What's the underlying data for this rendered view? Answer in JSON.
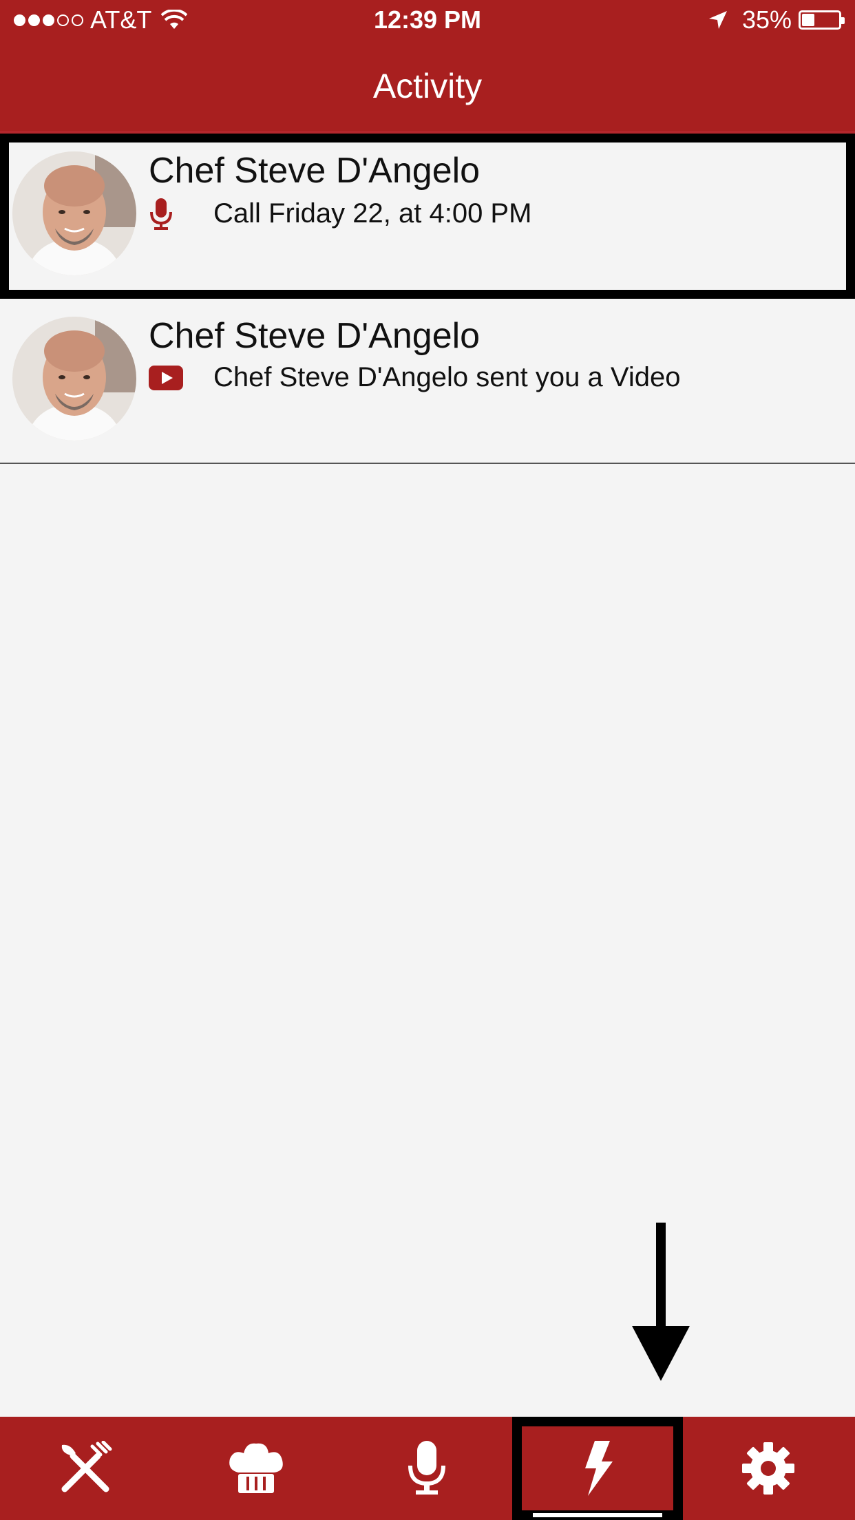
{
  "status_bar": {
    "carrier": "AT&T",
    "time": "12:39 PM",
    "battery_percent": "35%",
    "signal_bars_filled": 3,
    "signal_bars_total": 5,
    "battery_level": 0.35
  },
  "header": {
    "title": "Activity",
    "color": "#a81f1f"
  },
  "activities": [
    {
      "name": "Chef Steve D'Angelo",
      "icon": "microphone-icon",
      "text": "Call Friday 22, at 4:00 PM"
    },
    {
      "name": "Chef Steve D'Angelo",
      "icon": "video-play-icon",
      "text": "Chef Steve D'Angelo sent you a Video"
    }
  ],
  "tabbar": {
    "tabs": [
      {
        "icon": "fork-knife-icon"
      },
      {
        "icon": "chef-hat-icon"
      },
      {
        "icon": "microphone-icon"
      },
      {
        "icon": "lightning-icon",
        "active": true
      },
      {
        "icon": "gear-icon"
      }
    ]
  },
  "colors": {
    "brand_red": "#a81f1f",
    "background": "#f4f4f4"
  }
}
